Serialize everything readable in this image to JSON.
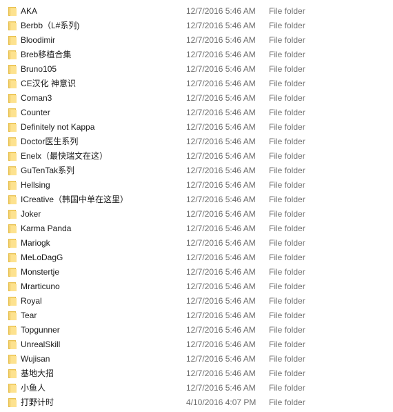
{
  "folders": [
    {
      "name": "AKA",
      "date": "12/7/2016 5:46 AM",
      "type": "File folder"
    },
    {
      "name": "Berbb（L#系列)",
      "date": "12/7/2016 5:46 AM",
      "type": "File folder"
    },
    {
      "name": "Bloodimir",
      "date": "12/7/2016 5:46 AM",
      "type": "File folder"
    },
    {
      "name": "Breb移植合集",
      "date": "12/7/2016 5:46 AM",
      "type": "File folder"
    },
    {
      "name": "Bruno105",
      "date": "12/7/2016 5:46 AM",
      "type": "File folder"
    },
    {
      "name": "CE汉化 神意识",
      "date": "12/7/2016 5:46 AM",
      "type": "File folder"
    },
    {
      "name": "Coman3",
      "date": "12/7/2016 5:46 AM",
      "type": "File folder"
    },
    {
      "name": "Counter",
      "date": "12/7/2016 5:46 AM",
      "type": "File folder"
    },
    {
      "name": "Definitely not Kappa",
      "date": "12/7/2016 5:46 AM",
      "type": "File folder"
    },
    {
      "name": "Doctor医生系列",
      "date": "12/7/2016 5:46 AM",
      "type": "File folder"
    },
    {
      "name": "Enelx（最快瑞文在这）",
      "date": "12/7/2016 5:46 AM",
      "type": "File folder"
    },
    {
      "name": "GuTenTak系列",
      "date": "12/7/2016 5:46 AM",
      "type": "File folder"
    },
    {
      "name": "Hellsing",
      "date": "12/7/2016 5:46 AM",
      "type": "File folder"
    },
    {
      "name": "ICreative（韩国中单在这里）",
      "date": "12/7/2016 5:46 AM",
      "type": "File folder"
    },
    {
      "name": "Joker",
      "date": "12/7/2016 5:46 AM",
      "type": "File folder"
    },
    {
      "name": "Karma Panda",
      "date": "12/7/2016 5:46 AM",
      "type": "File folder"
    },
    {
      "name": "Mariogk",
      "date": "12/7/2016 5:46 AM",
      "type": "File folder"
    },
    {
      "name": "MeLoDagG",
      "date": "12/7/2016 5:46 AM",
      "type": "File folder"
    },
    {
      "name": "Monstertje",
      "date": "12/7/2016 5:46 AM",
      "type": "File folder"
    },
    {
      "name": "Mrarticuno",
      "date": "12/7/2016 5:46 AM",
      "type": "File folder"
    },
    {
      "name": "Royal",
      "date": "12/7/2016 5:46 AM",
      "type": "File folder"
    },
    {
      "name": "Tear",
      "date": "12/7/2016 5:46 AM",
      "type": "File folder"
    },
    {
      "name": "Topgunner",
      "date": "12/7/2016 5:46 AM",
      "type": "File folder"
    },
    {
      "name": "UnrealSkill",
      "date": "12/7/2016 5:46 AM",
      "type": "File folder"
    },
    {
      "name": "Wujisan",
      "date": "12/7/2016 5:46 AM",
      "type": "File folder"
    },
    {
      "name": "基地大招",
      "date": "12/7/2016 5:46 AM",
      "type": "File folder"
    },
    {
      "name": "小鱼人",
      "date": "12/7/2016 5:46 AM",
      "type": "File folder"
    },
    {
      "name": "打野计时",
      "date": "4/10/2016 4:07 PM",
      "type": "File folder"
    }
  ],
  "icon": "folder-icon"
}
